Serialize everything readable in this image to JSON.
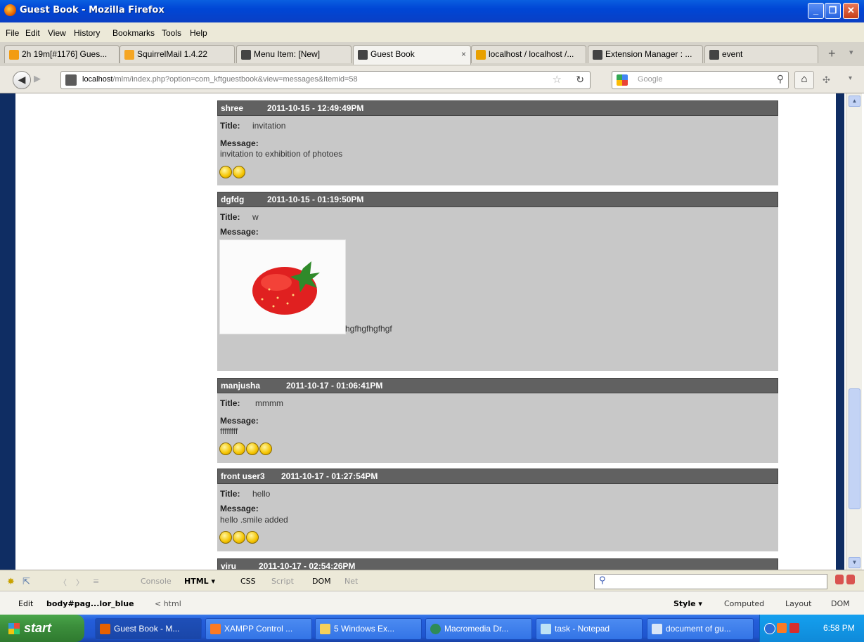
{
  "window": {
    "title": "Guest Book - Mozilla Firefox"
  },
  "menu": [
    "File",
    "Edit",
    "View",
    "History",
    "Bookmarks",
    "Tools",
    "Help"
  ],
  "tabs": [
    {
      "label": "2h 19m[#1176] Gues...",
      "color": "#f39c12"
    },
    {
      "label": "SquirrelMail 1.4.22",
      "color": "#f5a623"
    },
    {
      "label": "Menu Item: [New]",
      "color": "#444444"
    },
    {
      "label": "Guest Book",
      "color": "#444444",
      "close": "×"
    },
    {
      "label": "localhost / localhost /...",
      "color": "#e8a000"
    },
    {
      "label": "Extension Manager : ...",
      "color": "#444444"
    },
    {
      "label": "event",
      "color": "#444444"
    }
  ],
  "tabbar": {
    "new_tab": "+",
    "list": "▾"
  },
  "nav": {
    "url_host": "localhost",
    "url_path": "/mlm/index.php?option=com_kftguestbook&view=messages&Itemid=58",
    "search_placeholder": "Google"
  },
  "messages": [
    {
      "name": "shree",
      "date": "2011-10-15 - 12:49:49PM",
      "title_label": "Title:",
      "title": "invitation",
      "message_label": "Message:",
      "text": "invitation to exhibition of photoes",
      "smileys": [
        "grin-smiley-icon",
        "sad-smiley-icon"
      ]
    },
    {
      "name": "dgfdg",
      "date": "2011-10-15 - 01:19:50PM",
      "title_label": "Title:",
      "title": "w",
      "message_label": "Message:",
      "text": "hgfhgfhgfhgf",
      "image": "strawberry-image"
    },
    {
      "name": "manjusha",
      "date": "2011-10-17 - 01:06:41PM",
      "title_label": "Title:",
      "title": "mmmm",
      "message_label": "Message:",
      "text": "ffffffff",
      "smileys": [
        "crying-smiley-icon",
        "surprised-smiley-icon",
        "laughing-smiley-icon",
        "grin-smiley-icon"
      ]
    },
    {
      "name": "front user3",
      "date": "2011-10-17 - 01:27:54PM",
      "title_label": "Title:",
      "title": "hello",
      "message_label": "Message:",
      "text": "hello .smile added",
      "smileys": [
        "blush-smiley-icon",
        "thinking-smiley-icon",
        "tongue-smiley-icon"
      ]
    },
    {
      "name": "viru",
      "date": "2011-10-17 - 02:54:26PM"
    }
  ],
  "firebug": {
    "tabs": [
      "Console",
      "HTML ▾",
      "CSS",
      "Script",
      "DOM",
      "Net"
    ],
    "edit": "Edit",
    "path_current": "body#pag...lor_blue",
    "path_parent": "< html",
    "side_tabs": [
      "Style ▾",
      "Computed",
      "Layout",
      "DOM"
    ]
  },
  "taskbar": {
    "start": "start",
    "items": [
      "Guest Book - M...",
      "XAMPP Control ...",
      "5 Windows Ex...",
      "Macromedia Dr...",
      "task - Notepad",
      "document of gu..."
    ],
    "clock": "6:58 PM"
  }
}
